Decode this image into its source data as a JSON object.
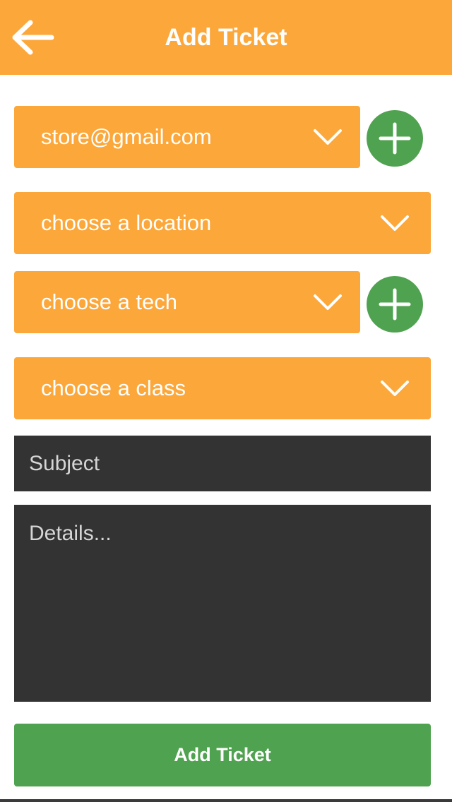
{
  "header": {
    "title": "Add Ticket",
    "back_icon": "arrow-left-icon",
    "background": "#fca73a"
  },
  "form": {
    "email_select": {
      "value": "store@gmail.com",
      "icon": "chevron-down-icon"
    },
    "email_add": {
      "icon": "plus-icon"
    },
    "location_select": {
      "value": "choose a location",
      "icon": "chevron-down-icon"
    },
    "tech_select": {
      "value": "choose a tech",
      "icon": "chevron-down-icon"
    },
    "tech_add": {
      "icon": "plus-icon"
    },
    "class_select": {
      "value": "choose a class",
      "icon": "chevron-down-icon"
    },
    "subject": {
      "placeholder": "Subject",
      "value": ""
    },
    "details": {
      "placeholder": "Details...",
      "value": ""
    },
    "submit_label": "Add Ticket"
  },
  "colors": {
    "accent": "#fca73a",
    "success": "#4fa24f",
    "field_dark": "#333333"
  }
}
